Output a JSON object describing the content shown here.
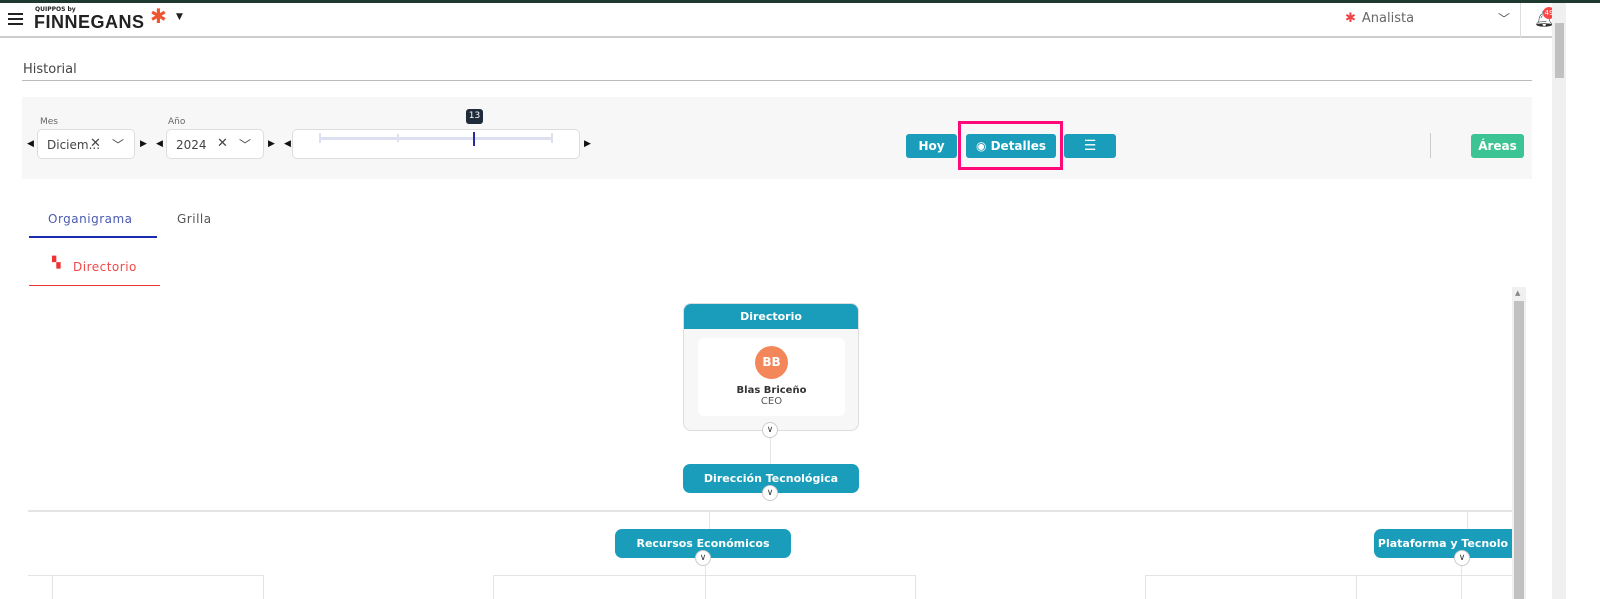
{
  "header": {
    "logo_small": "QUIPPOS by",
    "logo_big": "FINNEGANS",
    "role": "Analista",
    "notification_count": "49"
  },
  "page": {
    "title": "Historial"
  },
  "filters": {
    "month_label": "Mes",
    "month_value": "Diciem...",
    "year_label": "Año",
    "year_value": "2024",
    "slider_value": "13",
    "today_button": "Hoy",
    "details_button": "Detalles",
    "areas_button": "Áreas"
  },
  "tabs": [
    {
      "label": "Organigrama",
      "active": true
    },
    {
      "label": "Grilla",
      "active": false
    }
  ],
  "breadcrumb": {
    "label": "Directorio"
  },
  "org": {
    "root": {
      "title": "Directorio",
      "person_initials": "BB",
      "person_name": "Blas Briceño",
      "person_role": "CEO"
    },
    "level1": "Dirección Tecnológica",
    "level2": [
      "Recursos Económicos",
      "Plataforma y Tecnolo"
    ]
  },
  "colors": {
    "accent": "#1a9dba",
    "areas": "#3cc494",
    "highlight": "#ff0a78",
    "avatar": "#f4875a"
  }
}
